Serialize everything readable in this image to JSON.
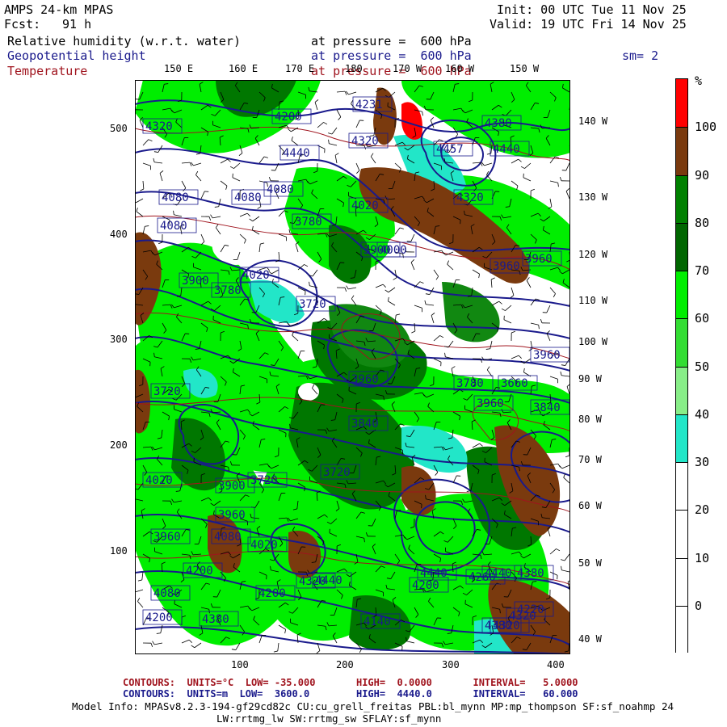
{
  "header": {
    "model_title": "AMPS 24-km MPAS",
    "fcst_label": "Fcst:",
    "fcst_value": "91 h",
    "init": "Init: 00 UTC Tue 11 Nov 25",
    "valid": "Valid: 19 UTC Fri 14 Nov 25",
    "field1": "Relative humidity (w.r.t. water)",
    "field1_level": "at pressure =  600 hPa",
    "field2": "Geopotential height",
    "field2_level": "at pressure =  600 hPa",
    "field3": "Temperature",
    "field3_level": "at pressure =  600 hPa",
    "smoothing": "sm= 2"
  },
  "colors": {
    "rh_30_40": "#22e6c8",
    "rh_40_50": "#ffffff",
    "rh_50_60": "#33cc33",
    "rh_60_70": "#00ee00",
    "rh_70_80": "#007700",
    "rh_80_90": "#118811",
    "rh_90_100": "#7a3a0e",
    "rh_100": "#ff0000",
    "height_contour": "#1a1a8c",
    "temp_contour": "#a0141e"
  },
  "lon_top_labels": [
    "150 E",
    "160 E",
    "170 E",
    "180",
    "170 W",
    "160 W",
    "150 W"
  ],
  "lon_right_labels": [
    "140 W",
    "130 W",
    "120 W",
    "110 W",
    "100 W",
    "90 W",
    "80 W",
    "70 W",
    "60 W",
    "50 W",
    "40 W"
  ],
  "y_axis_labels": [
    "500",
    "400",
    "300",
    "200",
    "100"
  ],
  "x_axis_labels": [
    "100",
    "200",
    "300",
    "400"
  ],
  "colorbar": {
    "unit": "%",
    "labels": [
      "100",
      "90",
      "80",
      "70",
      "60",
      "50",
      "40",
      "30",
      "20",
      "10",
      "0"
    ]
  },
  "height_labels": [
    "4320",
    "4200",
    "4231",
    "4320",
    "4380",
    "4457",
    "4440",
    "4440",
    "4080",
    "4080",
    "4080",
    "4020",
    "4080",
    "4320",
    "4000",
    "3900",
    "3900",
    "4020",
    "3960",
    "3960",
    "3780",
    "3780",
    "3720",
    "3720",
    "3960",
    "3960",
    "3660",
    "3900",
    "3780",
    "3960",
    "3840",
    "3840",
    "3720",
    "3720",
    "4020",
    "3960",
    "4080",
    "3960",
    "4200",
    "4320",
    "4020",
    "4080",
    "4200",
    "4440",
    "4200",
    "4260",
    "4140",
    "4200",
    "4380",
    "4440",
    "4440",
    "4380",
    "4320",
    "4380",
    "4320",
    "4220"
  ],
  "footer": {
    "temp_contours": "CONTOURS:  UNITS=°C  LOW= -35.000       HIGH=  0.0000       INTERVAL=   5.0000",
    "height_contours": "CONTOURS:  UNITS=m  LOW=  3600.0        HIGH=  4440.0       INTERVAL=   60.000",
    "model_info": "Model Info: MPASv8.2.3-194-gf29cd82c CU:cu_grell_freitas PBL:bl_mynn MP:mp_thompson SF:sf_noahmp 24",
    "model_info2": "LW:rrtmg_lw SW:rrtmg_sw SFLAY:sf_mynn"
  }
}
